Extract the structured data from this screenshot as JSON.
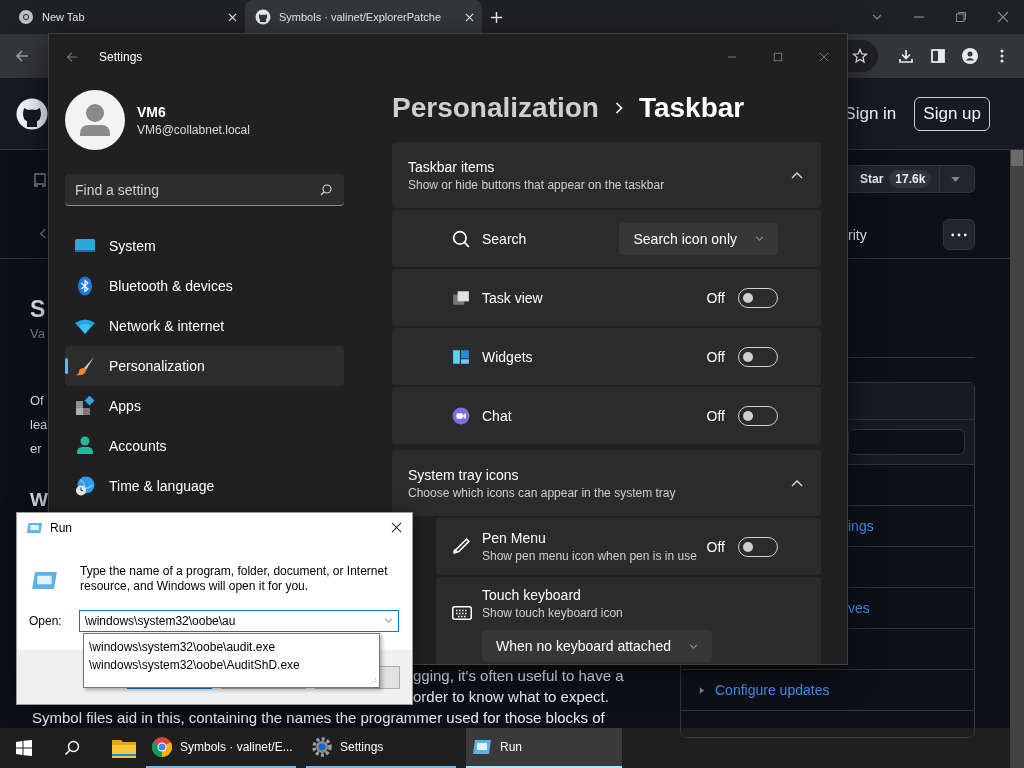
{
  "browser": {
    "tabs": [
      {
        "title": "New Tab",
        "selected": false
      },
      {
        "title": "Symbols · valinet/ExplorerPatche",
        "selected": true
      }
    ]
  },
  "github": {
    "sign_in": "Sign in",
    "sign_up": "Sign up",
    "star": {
      "label": "Star",
      "count": "17.6k"
    },
    "left_fragments": [
      {
        "kind": "heading",
        "text": "S"
      },
      {
        "kind": "subtitle",
        "text": "Va"
      },
      {
        "kind": "body",
        "text": "Of"
      },
      {
        "kind": "body",
        "text": "lea"
      },
      {
        "kind": "body",
        "text": "er"
      },
      {
        "kind": "heading2",
        "text": "W"
      }
    ],
    "tab_fragment": "rity",
    "sidebar_rows": [
      {
        "kind": "link",
        "text": "ings"
      },
      {
        "kind": "link",
        "text": "ves"
      },
      {
        "kind": "expandable",
        "text": "Configure updates",
        "expanded": false
      }
    ],
    "article_lines": [
      {
        "kind": "right",
        "text": "gging, it's often useful to have a"
      },
      {
        "kind": "right",
        "text": "order to know what to expect."
      },
      {
        "kind": "full",
        "text": "Symbol files aid in this, containing the names the programmer used for those blocks of"
      }
    ]
  },
  "settings": {
    "title": "Settings",
    "user": {
      "name": "VM6",
      "email": "VM6@collabnet.local"
    },
    "search": {
      "placeholder": "Find a setting"
    },
    "nav": [
      {
        "label": "System",
        "selected": false
      },
      {
        "label": "Bluetooth & devices",
        "selected": false
      },
      {
        "label": "Network & internet",
        "selected": false
      },
      {
        "label": "Personalization",
        "selected": true
      },
      {
        "label": "Apps",
        "selected": false
      },
      {
        "label": "Accounts",
        "selected": false
      },
      {
        "label": "Time & language",
        "selected": false
      }
    ],
    "breadcrumb": {
      "parent": "Personalization",
      "current": "Taskbar"
    },
    "sections": [
      {
        "title": "Taskbar items",
        "subtitle": "Show or hide buttons that appear on the taskbar",
        "expanded": true,
        "rows": [
          {
            "kind": "dropdown",
            "label": "Search",
            "value": "Search icon only"
          },
          {
            "kind": "toggle",
            "label": "Task view",
            "state": "Off",
            "on": false
          },
          {
            "kind": "toggle",
            "label": "Widgets",
            "state": "Off",
            "on": false
          },
          {
            "kind": "toggle",
            "label": "Chat",
            "state": "Off",
            "on": false
          }
        ]
      },
      {
        "title": "System tray icons",
        "subtitle": "Choose which icons can appear in the system tray",
        "expanded": true,
        "rows": [
          {
            "kind": "toggle",
            "label": "Pen Menu",
            "description": "Show pen menu icon when pen is in use",
            "state": "Off",
            "on": false
          },
          {
            "kind": "dropdown_below",
            "label": "Touch keyboard",
            "description": "Show touch keyboard icon",
            "value": "When no keyboard attached"
          }
        ]
      }
    ]
  },
  "run": {
    "title": "Run",
    "description": "Type the name of a program, folder, document, or Internet resource, and Windows will open it for you.",
    "open_label": "Open:",
    "value": "\\windows\\system32\\oobe\\au",
    "suggestions": [
      "\\windows\\system32\\oobe\\audit.exe",
      "\\windows\\system32\\oobe\\AuditShD.exe"
    ]
  },
  "taskbar": {
    "apps": [
      {
        "label": "Symbols · valinet/E...",
        "selected": false
      },
      {
        "label": "Settings",
        "selected": false
      },
      {
        "label": "Run",
        "selected": true
      }
    ]
  }
}
